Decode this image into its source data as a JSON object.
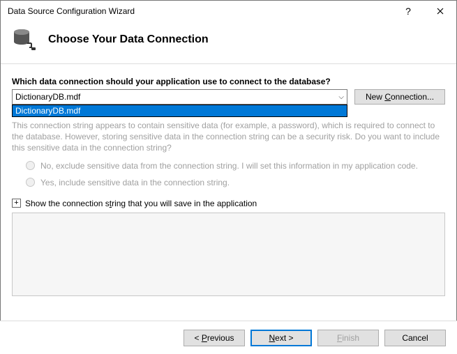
{
  "window": {
    "title": "Data Source Configuration Wizard"
  },
  "header": {
    "title": "Choose Your Data Connection"
  },
  "prompt": "Which data connection should your application use to connect to the database?",
  "connection": {
    "selected": "DictionaryDB.mdf",
    "options": [
      "DictionaryDB.mdf"
    ],
    "new_button_pre": "New ",
    "new_button_accel": "C",
    "new_button_post": "onnection..."
  },
  "sensitive": {
    "explain": "This connection string appears to contain sensitive data (for example, a password), which is required to connect to the database. However, storing sensitive data in the connection string can be a security risk. Do you want to include this sensitive data in the connection string?",
    "radio_no": "No, exclude sensitive data from the connection string. I will set this information in my application code.",
    "radio_yes": "Yes, include sensitive data in the connection string."
  },
  "expand": {
    "label_pre": "Show the connection s",
    "label_accel": "t",
    "label_post": "ring that you will save in the application"
  },
  "footer": {
    "previous_pre": "< ",
    "previous_accel": "P",
    "previous_post": "revious",
    "next_pre": "",
    "next_accel": "N",
    "next_post": "ext >",
    "finish_pre": "",
    "finish_accel": "F",
    "finish_post": "inish",
    "cancel": "Cancel"
  }
}
